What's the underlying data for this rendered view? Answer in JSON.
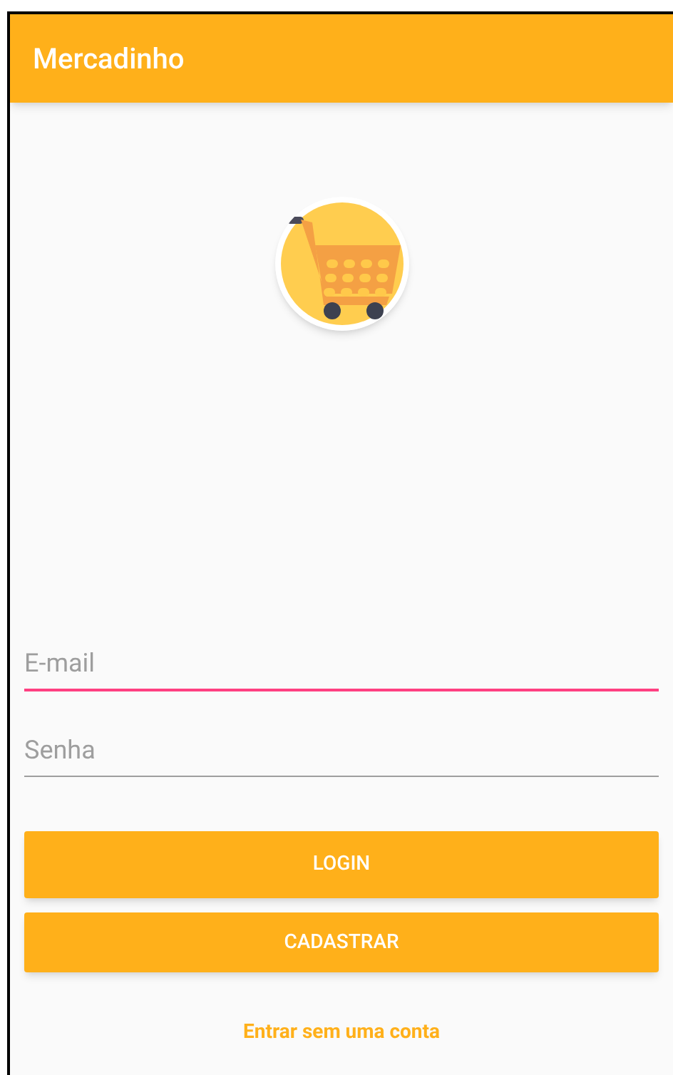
{
  "app_bar": {
    "title": "Mercadinho"
  },
  "fields": [
    {
      "placeholder": "E-mail",
      "focused": true
    },
    {
      "placeholder": "Senha",
      "focused": false
    }
  ],
  "buttons": [
    "LOGIN",
    "CADASTRAR"
  ],
  "link": "Entrar sem uma conta"
}
